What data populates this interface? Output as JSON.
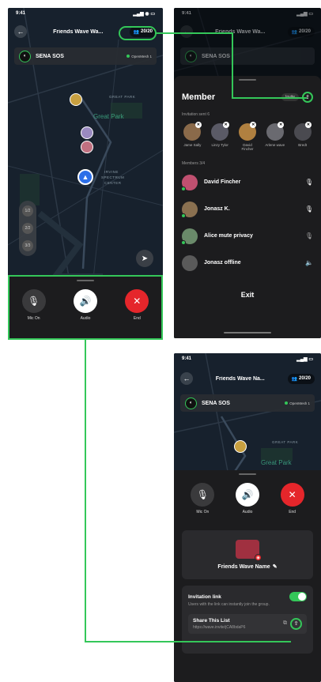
{
  "status_bar": {
    "time": "9:41"
  },
  "colors": {
    "accent_green": "#34c759",
    "end_red": "#e5262b",
    "nav_blue": "#2d6fe8"
  },
  "screen1": {
    "title": "Friends Wave Wa...",
    "member_count": "20/20",
    "sena_name": "SENA SOS",
    "sena_status": "OpenMesh 1",
    "map_labels": {
      "great_park_small": "GREAT PARK",
      "great_park": "Great Park",
      "irvine_1": "IRVINE",
      "irvine_2": "SPECTRUM",
      "irvine_3": "CENTER"
    },
    "side_stack": [
      "1/2",
      "2/2",
      "3/3"
    ],
    "call": {
      "mic_label": "Mic On",
      "audio_label": "Audio",
      "end_label": "End"
    }
  },
  "screen2": {
    "title": "Friends Wave Wa...",
    "member_count": "20/20",
    "sena_name": "SENA SOS",
    "sheet_title": "Member",
    "invite_btn": "Invite",
    "invitation_sent": "Invitation sent  6",
    "invitees": [
      {
        "name": "Jame Sally",
        "color": "#8a6a4a"
      },
      {
        "name": "Linzy Tylor",
        "color": "#5a5a66"
      },
      {
        "name": "David Fincher",
        "color": "#b08040"
      },
      {
        "name": "Arlene wave",
        "color": "#6a6a70"
      },
      {
        "name": "Bredt",
        "color": "#4a4a50"
      }
    ],
    "members_label": "Members  3/4",
    "members": [
      {
        "name": "David Fincher",
        "icon": "🎙",
        "color": "#c05070",
        "online": true
      },
      {
        "name": "Jonasz K.",
        "icon": "🎙",
        "color": "#8a7050",
        "online": true
      },
      {
        "name": "Alice mute privacy",
        "icon": "🎙",
        "color": "#6a8a6a",
        "online": true
      },
      {
        "name": "Jonasz offline",
        "icon": "🔈",
        "color": "#5a5a5a",
        "online": false
      }
    ],
    "exit_label": "Exit"
  },
  "screen3": {
    "time": "9:41",
    "title": "Friends Wave Na...",
    "member_count": "20/20",
    "sena_name": "SENA SOS",
    "sena_status": "OpenMesh 1",
    "map_labels": {
      "great_park_small": "GREAT PARK",
      "great_park": "Great Park"
    },
    "call": {
      "mic_label": "Mic On",
      "audio_label": "Audio",
      "end_label": "End"
    },
    "group_name": "Friends Wave Name",
    "invitation_link_title": "Invitation link",
    "invitation_link_desc": "Users with the link can instantly join the group.",
    "share_title": "Share This List",
    "share_url": "https://wave.invite/jCA8bdaP6"
  }
}
